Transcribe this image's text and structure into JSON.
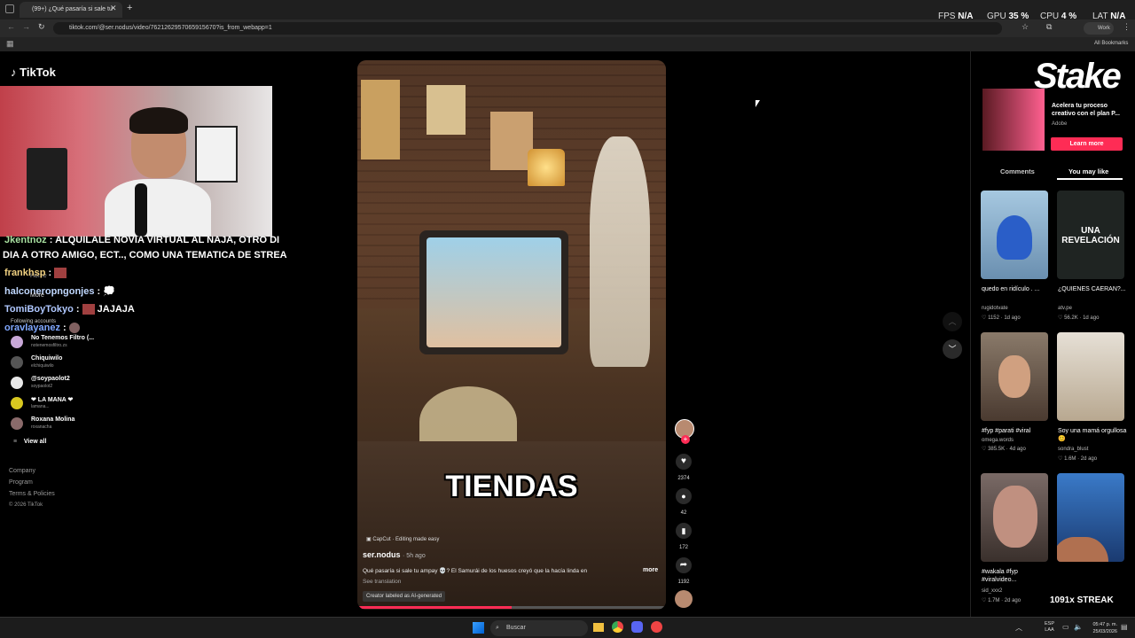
{
  "browser": {
    "tab_title": "(99+) ¿Qué pasaría si sale tu",
    "url": "tiktok.com/@ser.nodus/video/7621262957065915670?is_from_webapp=1",
    "profile": "Work",
    "bookmarks_label": "All Bookmarks"
  },
  "overlay_stats": {
    "fps_label": "FPS",
    "fps_value": "N/A",
    "gpu_label": "GPU",
    "gpu_value": "35 %",
    "cpu_label": "CPU",
    "cpu_value": "4 %",
    "lat_label": "LAT",
    "lat_value": "N/A"
  },
  "sidebar": {
    "logo": "TikTok",
    "nav": [
      "Home",
      "More"
    ],
    "following_label": "Following accounts",
    "accounts": [
      {
        "name": "No Tenemos Filtro (...",
        "handle": "notenemosfiltro.zs"
      },
      {
        "name": "Chiquiwilo",
        "handle": "elchiquiwilo"
      },
      {
        "name": "@soypaolot2",
        "handle": "soypaolot2"
      },
      {
        "name": "❤ LA MANA ❤",
        "handle": "lamana..."
      },
      {
        "name": "Roxana Molina",
        "handle": "roxanacha"
      }
    ],
    "view_all": "View all",
    "footer": [
      "Company",
      "Program",
      "Terms & Policies",
      "© 2026 TikTok"
    ]
  },
  "chat": [
    {
      "user": "Jkentnoz",
      "text": "ALQUILALE NOVIA VIRTUAL AL NAJA, OTRO DI"
    },
    {
      "user": "",
      "text": "DIA A OTRO AMIGO, ECT.., COMO UNA TEMATICA DE STREA"
    },
    {
      "user": "frankhsp",
      "text": ""
    },
    {
      "user": "halconeropngonjes",
      "text": ""
    },
    {
      "user": "TomiBoyTokyo",
      "text": "JAJAJA"
    },
    {
      "user": "oravlayanez",
      "text": ""
    }
  ],
  "video": {
    "caption_overlay": "TIENDAS",
    "capcut_label": "CapCut · Editing made easy",
    "author": "ser.nodus",
    "posted": "· 5h ago",
    "description": "Qué pasaría si sale tu ampay 💀? El Samurái de los huesos creyó que la hacía linda en",
    "more": "more",
    "see_translation": "See translation",
    "ai_label": "Creator labeled as AI-generated",
    "likes": "2374",
    "comments": "42",
    "saves": "172",
    "shares": "1192"
  },
  "ad": {
    "brand_watermark": "Stake",
    "title": "Acelera tu proceso creativo con el plan P...",
    "advertiser": "Adobe",
    "cta": "Learn more"
  },
  "right_tabs": [
    "Comments",
    "You may like"
  ],
  "cards": [
    {
      "title": "quedo en ridículo . ...",
      "user": "rugidotvate",
      "views": "1152",
      "age": "1d ago",
      "thumb_text": "",
      "bg": "#7aa4c8"
    },
    {
      "title": "¿QUIENES CAERAN?...",
      "user": "atv.pe",
      "views": "56.2K",
      "age": "1d ago",
      "thumb_text": "UNA REVELACIÓN",
      "bg": "#1f2422"
    },
    {
      "title": "#fyp #parati #viral",
      "user": "omega.words",
      "views": "385.5K",
      "age": "4d ago",
      "thumb_text": "",
      "bg": "#5a4a3e"
    },
    {
      "title": "Soy una mamá orgullosa 😊",
      "user": "sondra_blust",
      "views": "1.6M",
      "age": "2d ago",
      "thumb_text": "",
      "bg": "#cfc6b8"
    },
    {
      "title": "#wakala #fyp #viralvideo...",
      "user": "sid_xxx2",
      "views": "1.7M",
      "age": "2d ago",
      "thumb_text": "",
      "bg": "#6a5a55"
    },
    {
      "title": "",
      "user": "",
      "views": "",
      "age": "",
      "thumb_text": "",
      "bg": "#3a6fb0"
    }
  ],
  "streak_overlay": "1091x STREAK",
  "taskbar": {
    "search": "Buscar",
    "lang": "ESP",
    "lang2": "LAA",
    "time": "05:47 p. m.",
    "date": "25/03/2026"
  }
}
